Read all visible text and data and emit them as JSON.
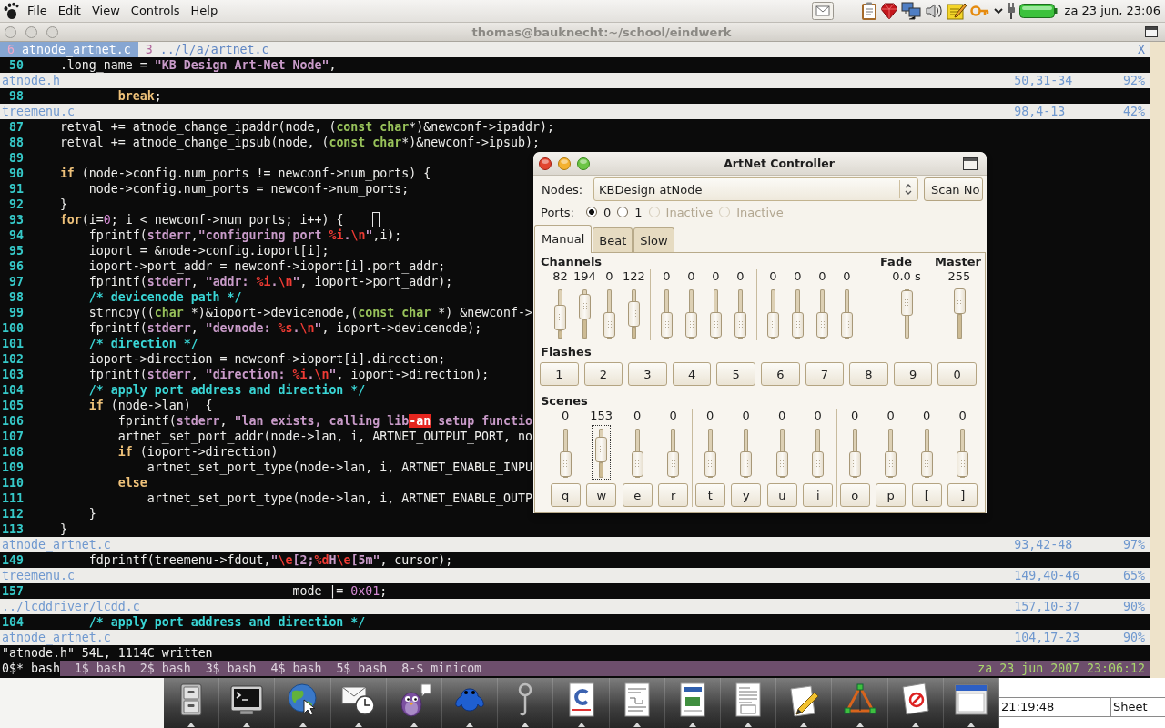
{
  "top_panel": {
    "menu": [
      "File",
      "Edit",
      "View",
      "Controls",
      "Help"
    ],
    "tray": [
      {
        "kind": "mail"
      },
      {
        "kind": "clipboard"
      },
      {
        "kind": "gem"
      },
      {
        "kind": "network"
      },
      {
        "kind": "speaker"
      },
      {
        "kind": "notes"
      },
      {
        "kind": "key"
      },
      {
        "kind": "chevron"
      },
      {
        "kind": "plug"
      },
      {
        "kind": "battery"
      }
    ],
    "clock": "za 23 jun, 23:06"
  },
  "terminal": {
    "title": "thomas@bauknecht:~/school/eindwerk",
    "tabs": [
      {
        "count": "6",
        "label": "atnode_artnet.c",
        "selected": true
      },
      {
        "count": "3",
        "label": "../l/a/artnet.c",
        "selected": false
      }
    ],
    "close_tab": "X",
    "windows": [
      {
        "lines": [
          {
            "number": "50",
            "cursor": false,
            "tokens": [
              {
                "kind": "plain",
                "text": "    .long_name = "
              },
              {
                "kind": "string",
                "text": "\"KB Design Art-Net Node\""
              },
              {
                "kind": "plain",
                "text": ","
              }
            ]
          }
        ],
        "status": {
          "file": "atnode.h",
          "position": "50,31-34",
          "percent": "92%"
        }
      },
      {
        "lines": [
          {
            "number": "98",
            "cursor": false,
            "tokens": [
              {
                "kind": "keyword",
                "text": "            break"
              },
              {
                "kind": "plain",
                "text": ";"
              }
            ]
          }
        ],
        "status": {
          "file": "treemenu.c",
          "position": "98,4-13",
          "percent": "42%"
        }
      },
      {
        "lines": [
          {
            "number": "87",
            "cursor": false,
            "tokens": [
              {
                "kind": "plain",
                "text": "    retval += atnode_change_ipaddr(node, ("
              },
              {
                "kind": "type",
                "text": "const char"
              },
              {
                "kind": "plain",
                "text": "*)&newconf->ipaddr);"
              }
            ]
          },
          {
            "number": "88",
            "cursor": false,
            "tokens": [
              {
                "kind": "plain",
                "text": "    retval += atnode_change_ipsub(node, ("
              },
              {
                "kind": "type",
                "text": "const char"
              },
              {
                "kind": "plain",
                "text": "*)&newconf->ipsub);"
              }
            ]
          },
          {
            "number": "89",
            "cursor": false
          },
          {
            "number": "90",
            "cursor": false,
            "tokens": [
              {
                "kind": "keyword",
                "text": "    if"
              },
              {
                "kind": "plain",
                "text": " (node->config.num_ports != newconf->num_ports) {"
              }
            ]
          },
          {
            "number": "91",
            "cursor": false,
            "tokens": [
              {
                "kind": "plain",
                "text": "        node->config.num_ports = newconf->num_ports;"
              }
            ]
          },
          {
            "number": "92",
            "cursor": false,
            "tokens": [
              {
                "kind": "plain",
                "text": "    }"
              }
            ]
          },
          {
            "number": "93",
            "cursor": true,
            "tokens": [
              {
                "kind": "keyword",
                "text": "    for"
              },
              {
                "kind": "plain",
                "text": "(i="
              },
              {
                "kind": "number",
                "text": "0"
              },
              {
                "kind": "plain",
                "text": "; i < newconf->num_ports; i++) {"
              }
            ]
          },
          {
            "number": "94",
            "cursor": false,
            "tokens": [
              {
                "kind": "plain",
                "text": "        fprintf("
              },
              {
                "kind": "constant",
                "text": "stderr"
              },
              {
                "kind": "plain",
                "text": ","
              },
              {
                "kind": "string",
                "text": "\"configuring port "
              },
              {
                "kind": "special",
                "text": "%i"
              },
              {
                "kind": "string",
                "text": "."
              },
              {
                "kind": "special",
                "text": "\\n"
              },
              {
                "kind": "string",
                "text": "\""
              },
              {
                "kind": "plain",
                "text": ",i);"
              }
            ]
          },
          {
            "number": "95",
            "cursor": false,
            "tokens": [
              {
                "kind": "plain",
                "text": "        ioport = &node->config.ioport[i];"
              }
            ]
          },
          {
            "number": "96",
            "cursor": false,
            "tokens": [
              {
                "kind": "plain",
                "text": "        ioport->port_addr = newconf->ioport[i].port_addr;"
              }
            ]
          },
          {
            "number": "97",
            "cursor": false,
            "tokens": [
              {
                "kind": "plain",
                "text": "        fprintf("
              },
              {
                "kind": "constant",
                "text": "stderr"
              },
              {
                "kind": "plain",
                "text": ", "
              },
              {
                "kind": "string",
                "text": "\"addr: "
              },
              {
                "kind": "special",
                "text": "%i"
              },
              {
                "kind": "string",
                "text": "."
              },
              {
                "kind": "special",
                "text": "\\n"
              },
              {
                "kind": "string",
                "text": "\""
              },
              {
                "kind": "plain",
                "text": ", ioport->port_addr);"
              }
            ]
          },
          {
            "number": "98",
            "cursor": false,
            "tokens": [
              {
                "kind": "comment",
                "text": "        /* devicenode path */"
              }
            ]
          },
          {
            "number": "99",
            "cursor": false,
            "tokens": [
              {
                "kind": "plain",
                "text": "        strncpy(("
              },
              {
                "kind": "type",
                "text": "char"
              },
              {
                "kind": "plain",
                "text": " *)&ioport->devicenode,("
              },
              {
                "kind": "type",
                "text": "const char"
              },
              {
                "kind": "plain",
                "text": " *) &newconf->"
              }
            ]
          },
          {
            "number": "100",
            "cursor": false,
            "tokens": [
              {
                "kind": "plain",
                "text": "        fprintf("
              },
              {
                "kind": "constant",
                "text": "stderr"
              },
              {
                "kind": "plain",
                "text": ", "
              },
              {
                "kind": "string",
                "text": "\"devnode: "
              },
              {
                "kind": "special",
                "text": "%s"
              },
              {
                "kind": "string",
                "text": "."
              },
              {
                "kind": "special",
                "text": "\\n"
              },
              {
                "kind": "string",
                "text": "\""
              },
              {
                "kind": "plain",
                "text": ", ioport->devicenode);"
              }
            ]
          },
          {
            "number": "101",
            "cursor": false,
            "tokens": [
              {
                "kind": "comment",
                "text": "        /* direction */"
              }
            ]
          },
          {
            "number": "102",
            "cursor": false,
            "tokens": [
              {
                "kind": "plain",
                "text": "        ioport->direction = newconf->ioport[i].direction;"
              }
            ]
          },
          {
            "number": "103",
            "cursor": false,
            "tokens": [
              {
                "kind": "plain",
                "text": "        fprintf("
              },
              {
                "kind": "constant",
                "text": "stderr"
              },
              {
                "kind": "plain",
                "text": ", "
              },
              {
                "kind": "string",
                "text": "\"direction: "
              },
              {
                "kind": "special",
                "text": "%i"
              },
              {
                "kind": "string",
                "text": "."
              },
              {
                "kind": "special",
                "text": "\\n"
              },
              {
                "kind": "string",
                "text": "\""
              },
              {
                "kind": "plain",
                "text": ", ioport->direction);"
              }
            ]
          },
          {
            "number": "104",
            "cursor": false,
            "tokens": [
              {
                "kind": "comment",
                "text": "        /* apply port address and direction */"
              }
            ]
          },
          {
            "number": "105",
            "cursor": false,
            "tokens": [
              {
                "kind": "keyword",
                "text": "        if"
              },
              {
                "kind": "plain",
                "text": " (node->lan)  {"
              }
            ]
          },
          {
            "number": "106",
            "cursor": false,
            "tokens": [
              {
                "kind": "plain",
                "text": "            fprintf("
              },
              {
                "kind": "constant",
                "text": "stderr"
              },
              {
                "kind": "plain",
                "text": ", "
              },
              {
                "kind": "string",
                "text": "\"lan exists, calling lib"
              },
              {
                "kind": "error",
                "text": "-an"
              },
              {
                "kind": "string",
                "text": " setup functio"
              }
            ]
          },
          {
            "number": "107",
            "cursor": false,
            "tokens": [
              {
                "kind": "plain",
                "text": "            artnet_set_port_addr(node->lan, i, ARTNET_OUTPUT_PORT, no"
              }
            ]
          },
          {
            "number": "108",
            "cursor": false,
            "tokens": [
              {
                "kind": "keyword",
                "text": "            if"
              },
              {
                "kind": "plain",
                "text": " (ioport->direction)"
              }
            ]
          },
          {
            "number": "109",
            "cursor": false,
            "tokens": [
              {
                "kind": "plain",
                "text": "                artnet_set_port_type(node->lan, i, ARTNET_ENABLE_INPU"
              }
            ]
          },
          {
            "number": "110",
            "cursor": false,
            "tokens": [
              {
                "kind": "keyword",
                "text": "            else"
              }
            ]
          },
          {
            "number": "111",
            "cursor": false,
            "tokens": [
              {
                "kind": "plain",
                "text": "                artnet_set_port_type(node->lan, i, ARTNET_ENABLE_OUTP"
              }
            ]
          },
          {
            "number": "112",
            "cursor": false,
            "tokens": [
              {
                "kind": "plain",
                "text": "        }"
              }
            ]
          },
          {
            "number": "113",
            "cursor": false,
            "tokens": [
              {
                "kind": "plain",
                "text": "    }"
              }
            ]
          }
        ],
        "status": {
          "file": "atnode_artnet.c",
          "position": "93,42-48",
          "percent": "97%"
        }
      },
      {
        "lines": [
          {
            "number": "149",
            "cursor": false,
            "tokens": [
              {
                "kind": "plain",
                "text": "        fdprintf(treemenu->fdout,"
              },
              {
                "kind": "string",
                "text": "\""
              },
              {
                "kind": "special",
                "text": "\\e"
              },
              {
                "kind": "string",
                "text": "[2;"
              },
              {
                "kind": "special",
                "text": "%d"
              },
              {
                "kind": "string",
                "text": "H"
              },
              {
                "kind": "special",
                "text": "\\e"
              },
              {
                "kind": "string",
                "text": "[5m\""
              },
              {
                "kind": "plain",
                "text": ", cursor);"
              }
            ]
          }
        ],
        "status": {
          "file": "treemenu.c",
          "position": "149,40-46",
          "percent": "65%"
        }
      },
      {
        "lines": [
          {
            "number": "157",
            "cursor": false,
            "tokens": [
              {
                "kind": "plain",
                "text": "                                    mode |= "
              },
              {
                "kind": "number",
                "text": "0x01"
              },
              {
                "kind": "plain",
                "text": ";"
              }
            ]
          }
        ],
        "status": {
          "file": "../lcddriver/lcdd.c",
          "position": "157,10-37",
          "percent": "90%"
        }
      },
      {
        "lines": [
          {
            "number": "104",
            "cursor": false,
            "tokens": [
              {
                "kind": "comment",
                "text": "        /* apply port address and direction */"
              }
            ]
          }
        ],
        "status": {
          "file": "atnode_artnet.c",
          "position": "104,17-23",
          "percent": "90%"
        }
      }
    ],
    "command_line": "\"atnode.h\" 54L, 1114C written",
    "screen_bar": {
      "windows": [
        {
          "label": "0$* bash",
          "selected": true
        },
        {
          "label": "1$ bash",
          "selected": false
        },
        {
          "label": "2$ bash",
          "selected": false
        },
        {
          "label": "3$ bash",
          "selected": false
        },
        {
          "label": "4$ bash",
          "selected": false
        },
        {
          "label": "5$ bash",
          "selected": false
        },
        {
          "label": "8-$ minicom",
          "selected": false
        }
      ],
      "clock": "za 23 jun 2007 23:06:12"
    }
  },
  "artnet_window": {
    "title": "ArtNet Controller",
    "nodes": {
      "label": "Nodes:",
      "value": "KBDesign atNode"
    },
    "scan_button": "Scan No",
    "ports": {
      "label": "Ports:",
      "options": [
        {
          "label": "0",
          "selected": true,
          "disabled": false
        },
        {
          "label": "1",
          "selected": false,
          "disabled": false
        },
        {
          "label": "Inactive",
          "selected": false,
          "disabled": true
        },
        {
          "label": "Inactive",
          "selected": false,
          "disabled": true
        }
      ]
    },
    "tabs": [
      {
        "label": "Manual",
        "selected": true
      },
      {
        "label": "Beat",
        "selected": false
      },
      {
        "label": "Slow",
        "selected": false
      }
    ],
    "channels": {
      "title": "Channels",
      "groups": [
        [
          {
            "reading": "82",
            "level": 0.32
          },
          {
            "reading": "194",
            "level": 0.76
          },
          {
            "reading": "0",
            "level": 0
          },
          {
            "reading": "122",
            "level": 0.48
          }
        ],
        [
          {
            "reading": "0",
            "level": 0
          },
          {
            "reading": "0",
            "level": 0
          },
          {
            "reading": "0",
            "level": 0
          },
          {
            "reading": "0",
            "level": 0
          }
        ],
        [
          {
            "reading": "0",
            "level": 0
          },
          {
            "reading": "0",
            "level": 0
          },
          {
            "reading": "0",
            "level": 0
          },
          {
            "reading": "0",
            "level": 0
          }
        ]
      ]
    },
    "fade": {
      "title": "Fade",
      "reading": "0.0 s",
      "level": 0,
      "inverted": true
    },
    "master": {
      "title": "Master",
      "reading": "255",
      "level": 1,
      "inverted": false
    },
    "flashes": {
      "title": "Flashes",
      "buttons": [
        "1",
        "2",
        "3",
        "4",
        "5",
        "6",
        "7",
        "8",
        "9",
        "0"
      ]
    },
    "scenes": {
      "title": "Scenes",
      "groups": [
        [
          {
            "reading": "0",
            "level": 0,
            "key": "q",
            "focused": false
          },
          {
            "reading": "153",
            "level": 0.6,
            "key": "w",
            "focused": true
          },
          {
            "reading": "0",
            "level": 0,
            "key": "e",
            "focused": false
          },
          {
            "reading": "0",
            "level": 0,
            "key": "r",
            "focused": false
          }
        ],
        [
          {
            "reading": "0",
            "level": 0,
            "key": "t",
            "focused": false
          },
          {
            "reading": "0",
            "level": 0,
            "key": "y",
            "focused": false
          },
          {
            "reading": "0",
            "level": 0,
            "key": "u",
            "focused": false
          },
          {
            "reading": "0",
            "level": 0,
            "key": "i",
            "focused": false
          }
        ],
        [
          {
            "reading": "0",
            "level": 0,
            "key": "o",
            "focused": false
          },
          {
            "reading": "0",
            "level": 0,
            "key": "p",
            "focused": false
          },
          {
            "reading": "0",
            "level": 0,
            "key": "[",
            "focused": false
          },
          {
            "reading": "0",
            "level": 0,
            "key": "]",
            "focused": false
          }
        ]
      ]
    }
  },
  "dock": {
    "items": [
      {
        "kind": "cabinet"
      },
      {
        "kind": "terminal"
      },
      {
        "kind": "globe"
      },
      {
        "kind": "mailclock"
      },
      {
        "kind": "bird"
      },
      {
        "kind": "frog"
      },
      {
        "kind": "magnifier"
      },
      {
        "kind": "cover"
      },
      {
        "kind": "schematic"
      },
      {
        "kind": "board"
      },
      {
        "kind": "datasheet"
      },
      {
        "kind": "pencil"
      },
      {
        "kind": "triangle"
      },
      {
        "kind": "paper"
      },
      {
        "kind": "window"
      }
    ]
  },
  "sheet": {
    "cells": [
      "21:19:48",
      "Sheet"
    ]
  }
}
